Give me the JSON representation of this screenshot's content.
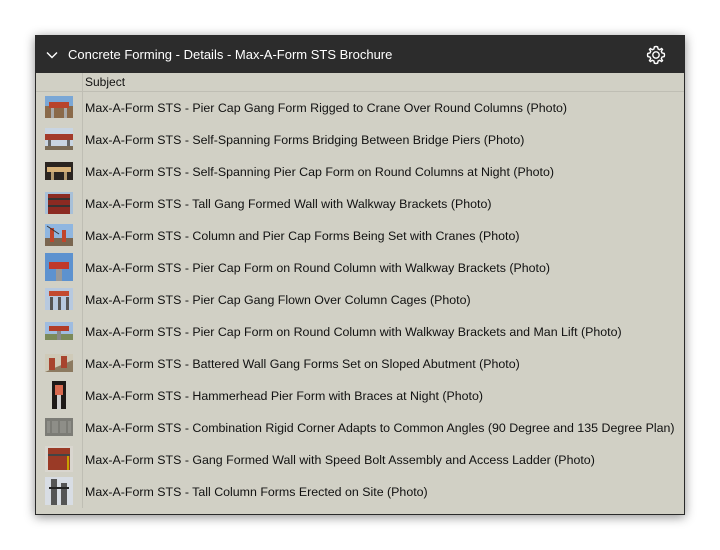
{
  "header": {
    "title": "Concrete Forming - Details - Max-A-Form STS Brochure",
    "chevron_icon": "chevron-down-icon",
    "settings_icon": "gear-icon"
  },
  "columns": {
    "subject": "Subject"
  },
  "colors": {
    "header_bg": "#2c2c2c",
    "list_bg": "#d1d0c5"
  },
  "rows": [
    {
      "subject": "Max-A-Form STS - Pier Cap Gang Form Rigged to Crane Over Round Columns (Photo)",
      "thumb": "photo-thumbnail"
    },
    {
      "subject": "Max-A-Form STS - Self-Spanning Forms Bridging Between Bridge Piers (Photo)",
      "thumb": "photo-thumbnail"
    },
    {
      "subject": "Max-A-Form STS - Self-Spanning Pier Cap Form on Round Columns at Night (Photo)",
      "thumb": "photo-thumbnail"
    },
    {
      "subject": "Max-A-Form STS - Tall Gang Formed Wall with Walkway Brackets (Photo)",
      "thumb": "photo-thumbnail"
    },
    {
      "subject": "Max-A-Form STS - Column and Pier Cap Forms Being Set with Cranes (Photo)",
      "thumb": "photo-thumbnail"
    },
    {
      "subject": "Max-A-Form STS - Pier Cap Form on Round Column with Walkway Brackets (Photo)",
      "thumb": "photo-thumbnail"
    },
    {
      "subject": "Max-A-Form STS - Pier Cap Gang Flown Over Column Cages (Photo)",
      "thumb": "photo-thumbnail"
    },
    {
      "subject": "Max-A-Form STS - Pier Cap Form on Round Column with Walkway Brackets and Man Lift (Photo)",
      "thumb": "photo-thumbnail"
    },
    {
      "subject": "Max-A-Form STS - Battered Wall Gang Forms Set on Sloped Abutment (Photo)",
      "thumb": "photo-thumbnail"
    },
    {
      "subject": "Max-A-Form STS - Hammerhead Pier Form with Braces at Night (Photo)",
      "thumb": "photo-thumbnail"
    },
    {
      "subject": "Max-A-Form STS - Combination Rigid Corner Adapts to Common Angles (90 Degree and 135 Degree Plan)",
      "thumb": "plan-thumbnail"
    },
    {
      "subject": "Max-A-Form STS - Gang Formed Wall with Speed Bolt Assembly and Access Ladder (Photo)",
      "thumb": "photo-thumbnail"
    },
    {
      "subject": "Max-A-Form STS - Tall Column Forms Erected on Site (Photo)",
      "thumb": "photo-thumbnail"
    }
  ]
}
